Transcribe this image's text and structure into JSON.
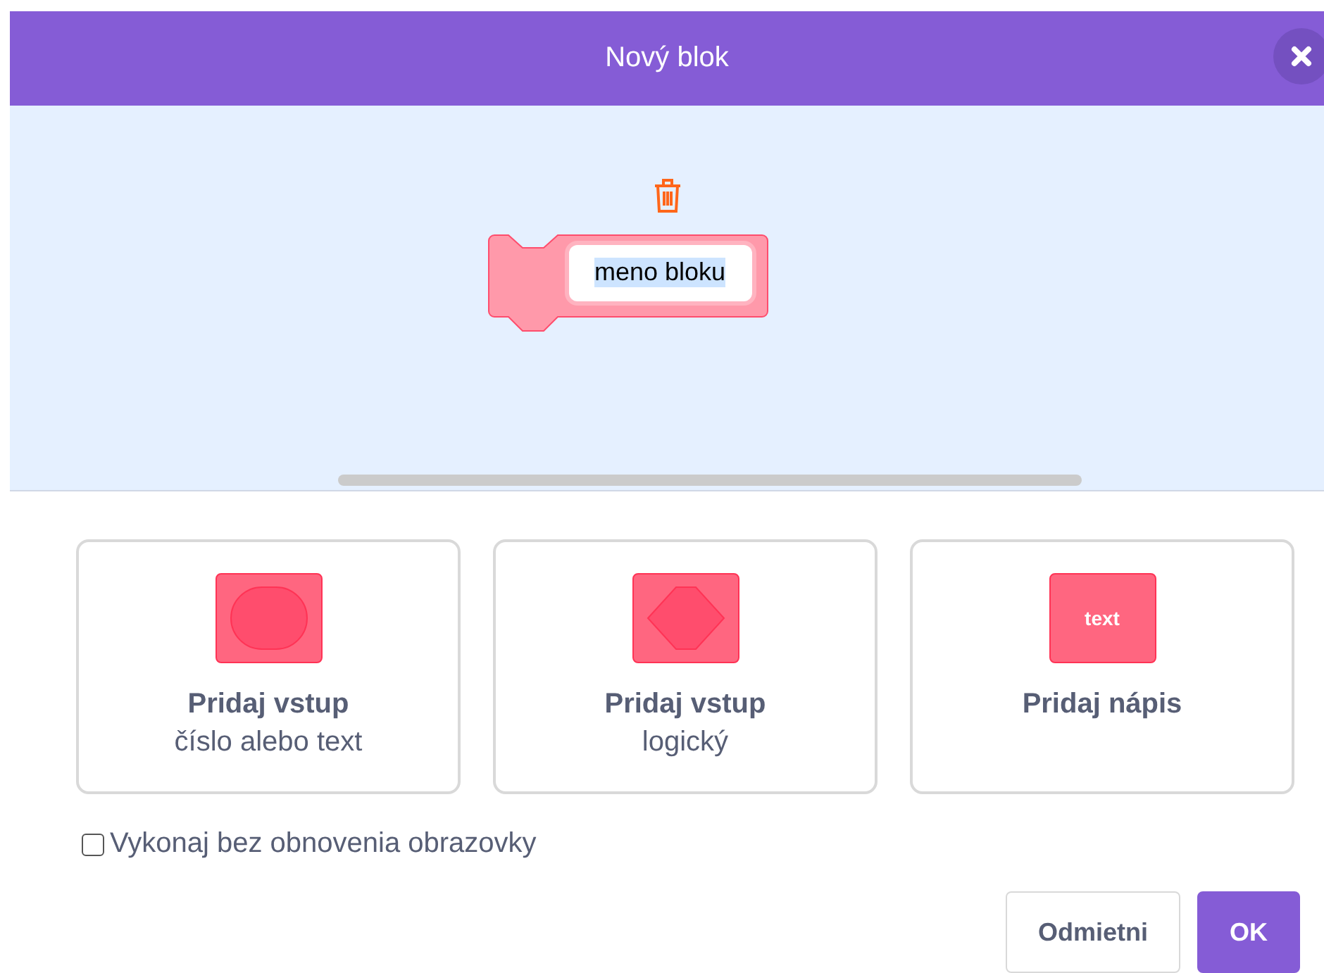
{
  "window": {
    "title": "Nový blok"
  },
  "block": {
    "name": "meno bloku",
    "name_selected": true
  },
  "options": [
    {
      "kind": "round",
      "title": "Pridaj vstup",
      "subtitle": "číslo alebo text"
    },
    {
      "kind": "hexagon",
      "title": "Pridaj vstup",
      "subtitle": "logický"
    },
    {
      "kind": "label",
      "title": "Pridaj nápis",
      "icon_text": "text"
    }
  ],
  "run_without_refresh": {
    "label": "Vykonaj bez obnovenia obrazovky",
    "checked": false
  },
  "buttons": [
    {
      "kind": "secondary",
      "label": "Odmietni"
    },
    {
      "kind": "primary",
      "label": "OK"
    }
  ]
}
